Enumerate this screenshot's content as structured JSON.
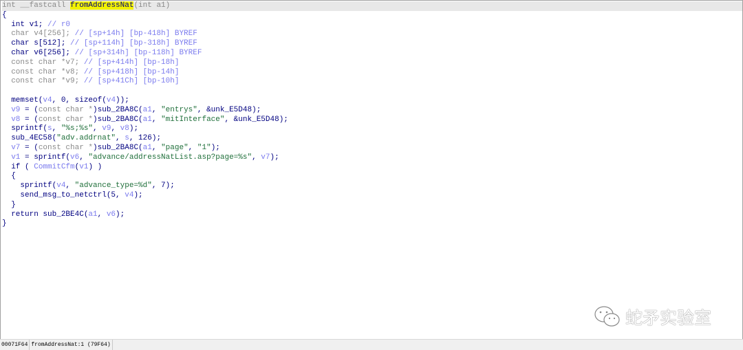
{
  "code_lines": [
    [
      [
        "int __fastcall ",
        "g"
      ],
      [
        "fromAddressNat",
        "hl"
      ],
      [
        "(int a1)",
        "g"
      ]
    ],
    [
      [
        "{",
        "k"
      ]
    ],
    [
      [
        "  int v1; ",
        "k"
      ],
      [
        "// r0",
        "c"
      ]
    ],
    [
      [
        "  char v4[256]; ",
        "g"
      ],
      [
        "// [sp+14h] [bp-418h] BYREF",
        "c"
      ]
    ],
    [
      [
        "  char s[512]; ",
        "k"
      ],
      [
        "// [sp+114h] [bp-318h] BYREF",
        "c"
      ]
    ],
    [
      [
        "  char v6[256]; ",
        "k"
      ],
      [
        "// [sp+314h] [bp-118h] BYREF",
        "c"
      ]
    ],
    [
      [
        "  const char *v7; ",
        "g"
      ],
      [
        "// [sp+414h] [bp-18h]",
        "c"
      ]
    ],
    [
      [
        "  const char *v8; ",
        "g"
      ],
      [
        "// [sp+418h] [bp-14h]",
        "c"
      ]
    ],
    [
      [
        "  const char *v9; ",
        "g"
      ],
      [
        "// [sp+41Ch] [bp-10h]",
        "c"
      ]
    ],
    [
      [
        "",
        ""
      ]
    ],
    [
      [
        "  memset(",
        "k"
      ],
      [
        "v4",
        "v"
      ],
      [
        ", 0, sizeof(",
        "k"
      ],
      [
        "v4",
        "v"
      ],
      [
        "));",
        "k"
      ]
    ],
    [
      [
        "  ",
        ""
      ],
      [
        "v9",
        "v"
      ],
      [
        " = (",
        "k"
      ],
      [
        "const char *",
        "g"
      ],
      [
        ")sub_2BA8C(",
        "k"
      ],
      [
        "a1",
        "v"
      ],
      [
        ", ",
        "k"
      ],
      [
        "\"entrys\"",
        "s"
      ],
      [
        ", &unk_E5D48);",
        "k"
      ]
    ],
    [
      [
        "  ",
        ""
      ],
      [
        "v8",
        "v"
      ],
      [
        " = (",
        "k"
      ],
      [
        "const char *",
        "g"
      ],
      [
        ")sub_2BA8C(",
        "k"
      ],
      [
        "a1",
        "v"
      ],
      [
        ", ",
        "k"
      ],
      [
        "\"mitInterface\"",
        "s"
      ],
      [
        ", &unk_E5D48);",
        "k"
      ]
    ],
    [
      [
        "  sprintf(",
        "k"
      ],
      [
        "s",
        "v"
      ],
      [
        ", ",
        "k"
      ],
      [
        "\"%s;%s\"",
        "s"
      ],
      [
        ", ",
        "k"
      ],
      [
        "v9",
        "v"
      ],
      [
        ", ",
        "k"
      ],
      [
        "v8",
        "v"
      ],
      [
        ");",
        "k"
      ]
    ],
    [
      [
        "  sub_4EC58(",
        "k"
      ],
      [
        "\"adv.addrnat\"",
        "s"
      ],
      [
        ", ",
        "k"
      ],
      [
        "s",
        "v"
      ],
      [
        ", 126);",
        "k"
      ]
    ],
    [
      [
        "  ",
        ""
      ],
      [
        "v7",
        "v"
      ],
      [
        " = (",
        "k"
      ],
      [
        "const char *",
        "g"
      ],
      [
        ")sub_2BA8C(",
        "k"
      ],
      [
        "a1",
        "v"
      ],
      [
        ", ",
        "k"
      ],
      [
        "\"page\"",
        "s"
      ],
      [
        ", ",
        "k"
      ],
      [
        "\"1\"",
        "s"
      ],
      [
        ");",
        "k"
      ]
    ],
    [
      [
        "  ",
        ""
      ],
      [
        "v1",
        "v"
      ],
      [
        " = sprintf(",
        "k"
      ],
      [
        "v6",
        "v"
      ],
      [
        ", ",
        "k"
      ],
      [
        "\"advance/addressNatList.asp?page=%s\"",
        "s"
      ],
      [
        ", ",
        "k"
      ],
      [
        "v7",
        "v"
      ],
      [
        ");",
        "k"
      ]
    ],
    [
      [
        "  if ( ",
        "k"
      ],
      [
        "CommitCfm",
        "c"
      ],
      [
        "(",
        "k"
      ],
      [
        "v1",
        "v"
      ],
      [
        ") )",
        "k"
      ]
    ],
    [
      [
        "  {",
        "k"
      ]
    ],
    [
      [
        "    sprintf(",
        "k"
      ],
      [
        "v4",
        "v"
      ],
      [
        ", ",
        "k"
      ],
      [
        "\"advance_type=%d\"",
        "s"
      ],
      [
        ", 7);",
        "k"
      ]
    ],
    [
      [
        "    send_msg_to_netctrl(5, ",
        "k"
      ],
      [
        "v4",
        "v"
      ],
      [
        ");",
        "k"
      ]
    ],
    [
      [
        "  }",
        "k"
      ]
    ],
    [
      [
        "  return sub_2BE4C(",
        "k"
      ],
      [
        "a1",
        "v"
      ],
      [
        ", ",
        "k"
      ],
      [
        "v6",
        "v"
      ],
      [
        ");",
        "k"
      ]
    ],
    [
      [
        "}",
        "k"
      ]
    ]
  ],
  "status_bar": {
    "address": "00071F64",
    "location": "fromAddressNat:1 (79F64)"
  },
  "watermark": {
    "text": "蛇矛实验室",
    "icon": "wechat-icon"
  },
  "colors": {
    "keyword": "#000080",
    "comment": "#7b7bee",
    "string": "#1f6f3a",
    "highlight": "#f2f200"
  }
}
